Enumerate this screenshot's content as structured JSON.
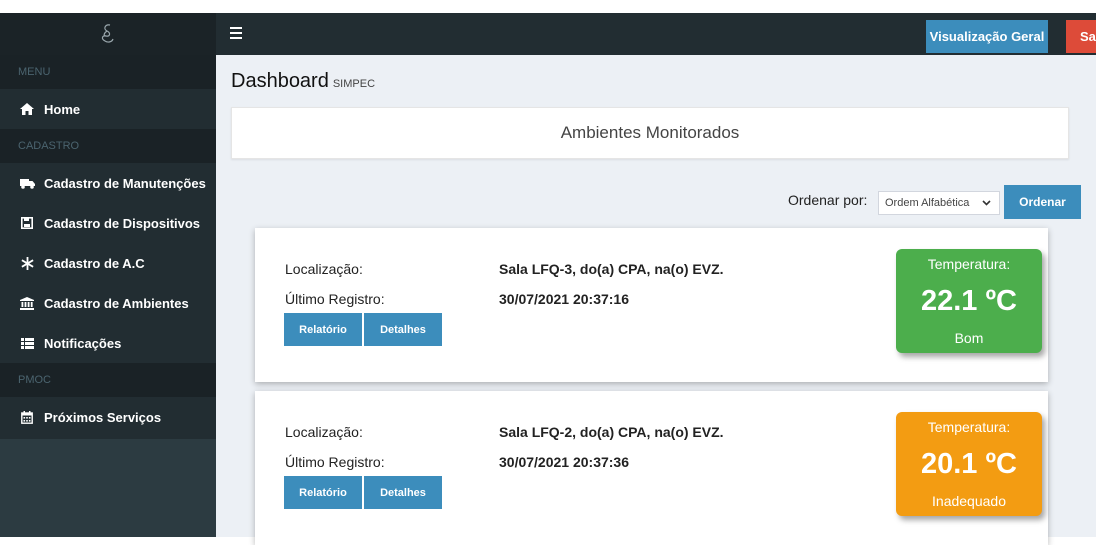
{
  "colors": {
    "sidebar_bg": "#222d32",
    "primary": "#3c8dbc",
    "danger": "#dd4b39",
    "good": "#4cae4c",
    "warning": "#f39c12"
  },
  "header": {
    "menu_icon": "hamburger-icon",
    "btn_geral": "Visualização Geral",
    "btn_sair": "Sair"
  },
  "sidebar": {
    "logo_icon": "brand-logo-icon",
    "sections": {
      "menu": "MENU",
      "cadastro": "CADASTRO",
      "pmoc": "PMOC"
    },
    "items": {
      "home": "Home",
      "manutencoes": "Cadastro de Manutenções",
      "dispositivos": "Cadastro de Dispositivos",
      "ac": "Cadastro de A.C",
      "ambientes": "Cadastro de Ambientes",
      "notificacoes": "Notificações",
      "servicos": "Próximos Serviços"
    }
  },
  "page": {
    "title": "Dashboard",
    "subtitle": "SIMPEC",
    "box_title": "Ambientes Monitorados",
    "sort_label": "Ordenar por:",
    "sort_selected": "Ordem Alfabética",
    "sort_button": "Ordenar"
  },
  "cards": [
    {
      "loc_label": "Localização:",
      "loc_value": "Sala LFQ-3, do(a) CPA, na(o) EVZ.",
      "reg_label": "Último Registro:",
      "reg_value": "30/07/2021 20:37:16",
      "btn_relatorio": "Relatório",
      "btn_detalhes": "Detalhes",
      "temp_label": "Temperatura:",
      "temp_value": "22.1 ºC",
      "temp_status": "Bom",
      "temp_color": "#4cae4c"
    },
    {
      "loc_label": "Localização:",
      "loc_value": "Sala LFQ-2, do(a) CPA, na(o) EVZ.",
      "reg_label": "Último Registro:",
      "reg_value": "30/07/2021 20:37:36",
      "btn_relatorio": "Relatório",
      "btn_detalhes": "Detalhes",
      "temp_label": "Temperatura:",
      "temp_value": "20.1 ºC",
      "temp_status": "Inadequado",
      "temp_color": "#f39c12"
    }
  ]
}
